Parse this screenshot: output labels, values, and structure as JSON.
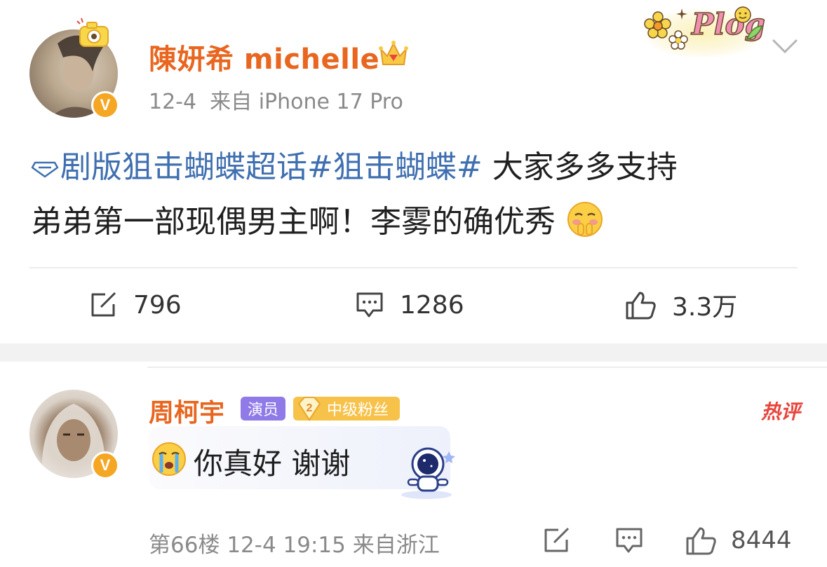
{
  "post": {
    "author": "陳妍希 michelle",
    "date": "12-4",
    "source": "来自 iPhone 17 Pro",
    "topic_supertopic": "剧版狙击蝴蝶超话",
    "topic_hashtag": "#狙击蝴蝶#",
    "text_line1_rest": " 大家多多支持",
    "text_line2": "弟弟第一部现偶男主啊！李雾的确优秀",
    "reposts": "796",
    "comments": "1286",
    "likes": "3.3万",
    "decoration_label": "Plog",
    "verified_badge": "V"
  },
  "comment": {
    "author": "周柯宇",
    "tag_actor": "演员",
    "fan_level": "2",
    "fan_label": "中级粉丝",
    "hot_label": "热评",
    "text": "你真好 谢谢",
    "floor": "第66楼",
    "datetime": "12-4 19:15",
    "location": "来自浙江",
    "likes": "8444",
    "verified_badge": "V"
  },
  "colors": {
    "username": "#e8661f",
    "topic": "#3f6fb0",
    "verified": "#f5a623",
    "actor_tag": "#8f7ae8",
    "fan_tag": "#f7c24a",
    "hot": "#e8453c"
  },
  "icons": {
    "repost": "repost-icon",
    "comment": "comment-icon",
    "like": "like-icon",
    "dropdown": "chevron-down-icon",
    "supertopic": "diamond-icon"
  }
}
